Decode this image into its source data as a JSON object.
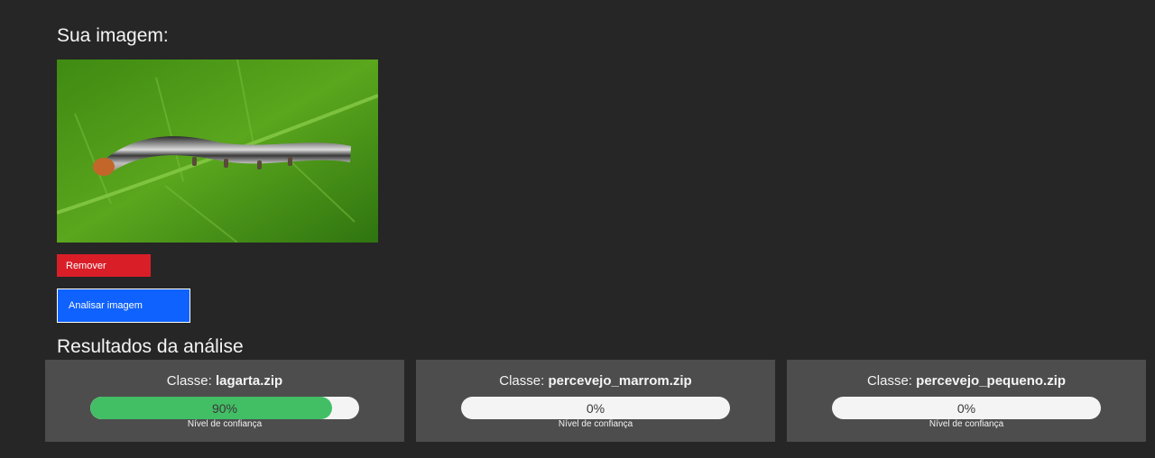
{
  "upload": {
    "heading": "Sua imagem:",
    "remove_label": "Remover",
    "analyze_label": "Analisar imagem"
  },
  "results": {
    "heading": "Resultados da análise",
    "class_prefix": "Classe:",
    "confidence_label": "Nível de confiança",
    "cards": [
      {
        "class_name": "lagarta.zip",
        "confidence": 90,
        "confidence_text": "90%"
      },
      {
        "class_name": "percevejo_marrom.zip",
        "confidence": 0,
        "confidence_text": "0%"
      },
      {
        "class_name": "percevejo_pequeno.zip",
        "confidence": 0,
        "confidence_text": "0%"
      }
    ]
  },
  "colors": {
    "background": "#262626",
    "card": "#4d4d4d",
    "remove_button": "#da1e28",
    "analyze_button": "#0f62fe",
    "confidence_fill": "#42be65",
    "bar_track": "#f4f4f4"
  }
}
